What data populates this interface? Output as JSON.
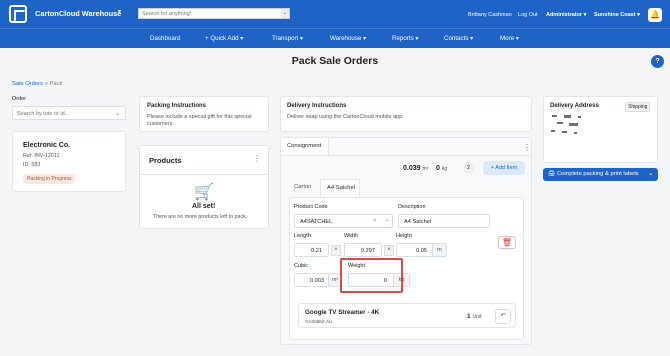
{
  "app": {
    "brand": "CartonCloud Warehouse",
    "search_placeholder": "Search for anything!",
    "user": "Brittany Cashman",
    "logout": "Log Out",
    "role": "Administrator",
    "location": "Sunshine Coast"
  },
  "nav": [
    "Dashboard",
    "+ Quick Add",
    "Transport",
    "Warehouse",
    "Reports",
    "Contacts",
    "More"
  ],
  "page": {
    "title": "Pack Sale Orders",
    "breadcrumb": [
      "Sale Orders",
      "Pack"
    ]
  },
  "order_panel": {
    "label": "Order",
    "placeholder": "Search by tote or id...",
    "customer": "Electronic Co.",
    "ref": "Ref: INV-12011",
    "id": "ID: 583",
    "status": "Packing in Progress"
  },
  "packing_instructions": {
    "title": "Packing Instructions",
    "text": "Please include a special gift for this special customers."
  },
  "products": {
    "title": "Products",
    "empty_title": "All set!",
    "empty_text": "There are no more products left to pack."
  },
  "delivery_instructions": {
    "title": "Delivery Instructions",
    "text": "Deliver asap using the CartonCloud mobile app."
  },
  "consignment": {
    "tab": "Consignment",
    "cubic_total": "0.039",
    "cubic_unit": "m³",
    "weight_total": "0",
    "weight_unit": "kg",
    "count": "2",
    "add_item": "+ Add Item"
  },
  "package_tabs": [
    "Carton",
    "A4 Satchel"
  ],
  "package_form": {
    "product_code_label": "Product Code",
    "product_code": "A4SATCHEL",
    "description_label": "Description",
    "description": "A4 Satchel",
    "length_label": "Length",
    "length": "0.21",
    "width_label": "Width",
    "width": "0.297",
    "height_label": "Height",
    "height": "0.05",
    "height_unit": "m",
    "cubic_label": "Cubic",
    "cubic": "0.003",
    "cubic_unit": "m³",
    "weight_label": "Weight",
    "weight": "0",
    "weight_unit": "kg"
  },
  "packed_item": {
    "name": "Google TV Streamer - 4K",
    "code": "GA05882-AU",
    "qty": "1",
    "unit": "Unit"
  },
  "delivery_address": {
    "title": "Delivery Address",
    "tag": "Shipping"
  },
  "actions": {
    "complete": "Complete packing & print labels"
  },
  "icons": {
    "bell": "bell-icon",
    "help": "help-icon",
    "printer": "printer-icon",
    "trash": "trash-icon",
    "undo": "undo-icon",
    "cart": "cart-icon"
  },
  "colors": {
    "primary": "#1f63c6",
    "danger": "#e04848",
    "status_bg": "#fbe7df"
  }
}
